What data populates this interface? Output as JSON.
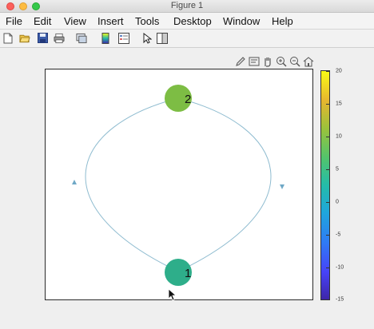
{
  "window": {
    "title": "Figure 1"
  },
  "menu": [
    "File",
    "Edit",
    "View",
    "Insert",
    "Tools",
    "Desktop",
    "Window",
    "Help"
  ],
  "toolbar": {
    "icons": [
      "new-figure-icon",
      "open-file-icon",
      "save-icon",
      "print-icon",
      "link-plot-icon",
      "insert-colorbar-icon",
      "insert-legend-icon",
      "pointer-icon",
      "plot-tools-icon"
    ]
  },
  "axes_toolbar": {
    "icons": [
      "brush-icon",
      "data-cursor-icon",
      "pan-icon",
      "zoom-in-icon",
      "zoom-out-icon",
      "home-icon"
    ]
  },
  "graph": {
    "nodes": [
      {
        "label": "1",
        "color": "#2eae8a"
      },
      {
        "label": "2",
        "color": "#7dbd44"
      }
    ],
    "edge_color": "#8fbcd0"
  },
  "colorbar": {
    "ticks": [
      "20",
      "15",
      "10",
      "5",
      "0",
      "-5",
      "-10",
      "-15"
    ]
  }
}
